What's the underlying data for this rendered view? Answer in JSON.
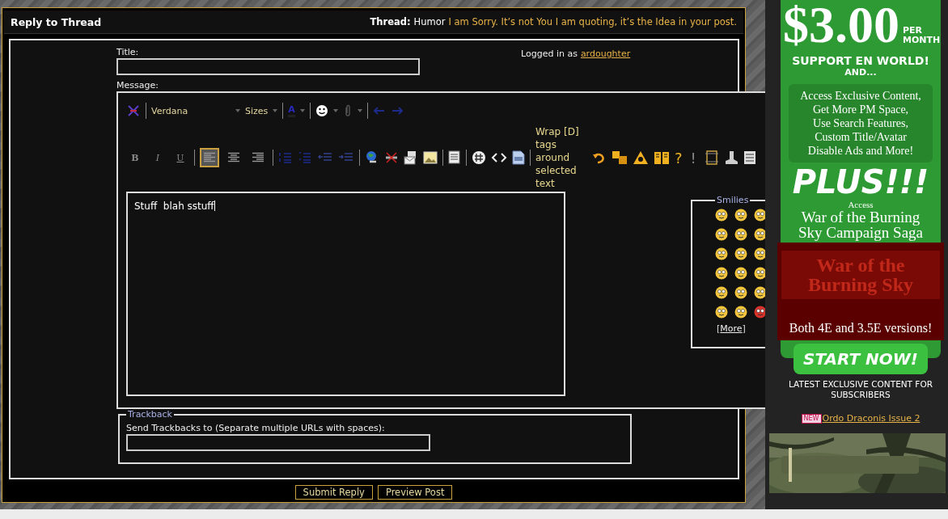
{
  "panel": {
    "title": "Reply to Thread",
    "thread_label": "Thread:",
    "forum": "Humor",
    "thread_title": "I am Sorry. It’s not You I am quoting, it’s the Idea in your post."
  },
  "form": {
    "title_label": "Title:",
    "logged_in_label": "Logged in as",
    "username": "ardoughter",
    "message_label": "Message:"
  },
  "toolbar": {
    "font": "Verdana",
    "size": "Sizes",
    "color_glyph": "A",
    "bold": "B",
    "italic": "I",
    "underline": "U",
    "alignments": [
      {
        "selected": true
      },
      {
        "selected": false
      },
      {
        "selected": false
      }
    ],
    "wrap_tags": "Wrap [D] tags around selected text",
    "help": "?",
    "alert": "!"
  },
  "editor": {
    "value": "Stuff  blah sstuff"
  },
  "smilies": {
    "legend": "Smilies",
    "open_bracket": "[",
    "more": "More",
    "close_bracket": "]"
  },
  "trackback": {
    "legend": "Trackback",
    "label": "Send Trackbacks to (Separate multiple URLs with spaces):"
  },
  "buttons": [
    "Submit Reply",
    "Preview Post"
  ],
  "ad": {
    "price": "$3.00",
    "per_month": "PER MONTH",
    "support": "SUPPORT EN WORLD!",
    "and": "AND...",
    "features": [
      "Access Exclusive Content,",
      "Get More PM Space,",
      "Use Search Features,",
      "Custom Title/Avatar",
      "Disable Ads and More!"
    ],
    "plus": "PLUS!!!",
    "access": "Access",
    "campaign": "War of the Burning Sky Campaign Saga",
    "logo": "War of the Burning Sky",
    "versions": "Both 4E and 3.5E versions!",
    "cta": "START NOW!"
  },
  "sidebar": {
    "heading": "LATEST EXCLUSIVE CONTENT FOR SUBSCRIBERS",
    "badge": "NEW",
    "link": "Ordo Draconis Issue 2"
  }
}
